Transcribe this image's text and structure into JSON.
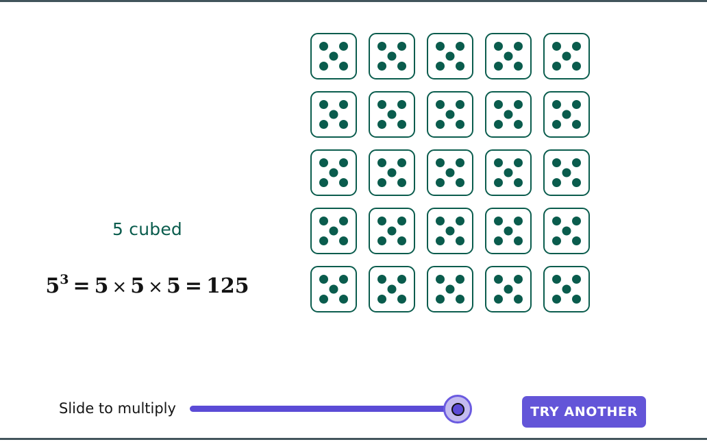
{
  "theme": {
    "die_green": "#0a5c4d",
    "slider_purple": "#5b4bd6",
    "thumb_fill": "#c3bbef",
    "button_purple": "#6355d8",
    "rule_color": "#42555c",
    "background": "#ffffff"
  },
  "model": {
    "base": 5,
    "exponent": 3,
    "result": 125,
    "dice_count": 25,
    "pips_per_die": 5,
    "grid_rows": 5,
    "grid_cols": 5
  },
  "title_label": "5 cubed",
  "equation": {
    "base": "5",
    "exponent": "3",
    "equals_1": "=",
    "factor_1": "5",
    "times_1": "×",
    "factor_2": "5",
    "times_2": "×",
    "factor_3": "5",
    "equals_2": "=",
    "result": "125",
    "plain_text": "5³ = 5 × 5 × 5 = 125"
  },
  "slider": {
    "label": "Slide to multiply",
    "value": 5,
    "min": 1,
    "max": 5,
    "percent": 100
  },
  "button": {
    "try_another_label": "TRY ANOTHER"
  },
  "dice": [
    {
      "face": 5
    },
    {
      "face": 5
    },
    {
      "face": 5
    },
    {
      "face": 5
    },
    {
      "face": 5
    },
    {
      "face": 5
    },
    {
      "face": 5
    },
    {
      "face": 5
    },
    {
      "face": 5
    },
    {
      "face": 5
    },
    {
      "face": 5
    },
    {
      "face": 5
    },
    {
      "face": 5
    },
    {
      "face": 5
    },
    {
      "face": 5
    },
    {
      "face": 5
    },
    {
      "face": 5
    },
    {
      "face": 5
    },
    {
      "face": 5
    },
    {
      "face": 5
    },
    {
      "face": 5
    },
    {
      "face": 5
    },
    {
      "face": 5
    },
    {
      "face": 5
    },
    {
      "face": 5
    }
  ]
}
